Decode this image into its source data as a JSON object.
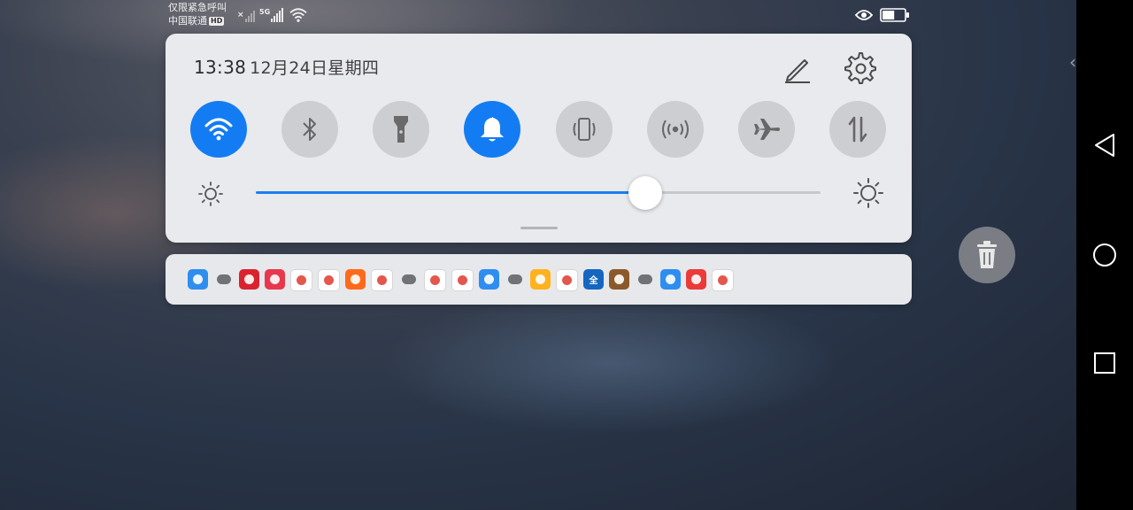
{
  "status_bar": {
    "emergency_text": "仅限紧急呼叫",
    "carrier": "中国联通",
    "hd_badge": "HD",
    "network_label": "5G",
    "battery_level": 0.55
  },
  "header": {
    "time": "13:38",
    "date": "12月24日星期四"
  },
  "toggles": [
    {
      "name": "wifi-toggle",
      "icon": "wifi-icon",
      "active": true
    },
    {
      "name": "bluetooth-toggle",
      "icon": "bluetooth-icon",
      "active": false
    },
    {
      "name": "flashlight-toggle",
      "icon": "flashlight-icon",
      "active": false
    },
    {
      "name": "sound-toggle",
      "icon": "bell-icon",
      "active": true
    },
    {
      "name": "auto-rotate-toggle",
      "icon": "rotate-phone-icon",
      "active": false
    },
    {
      "name": "hotspot-toggle",
      "icon": "hotspot-icon",
      "active": false
    },
    {
      "name": "airplane-mode-toggle",
      "icon": "airplane-icon",
      "active": false
    },
    {
      "name": "mobile-data-toggle",
      "icon": "mobile-data-icon",
      "active": false
    }
  ],
  "brightness": {
    "level": 0.69
  },
  "notification_apps": [
    {
      "icon": "wifi-app-icon",
      "color": "#2f8df0"
    },
    {
      "icon": "layers-icon",
      "color": "#e7e8eb"
    },
    {
      "icon": "checker-app-icon",
      "color": "#d9232f"
    },
    {
      "icon": "heart-app-icon",
      "color": "#e8384d"
    },
    {
      "icon": "map-pin-app-icon",
      "color": "#ffffff"
    },
    {
      "icon": "circle-app-icon",
      "color": "#ffffff"
    },
    {
      "icon": "play-orange-app-icon",
      "color": "#ff6a1a"
    },
    {
      "icon": "music-red-app-icon",
      "color": "#ffffff"
    },
    {
      "icon": "wechat-icon",
      "color": "#e7e8eb"
    },
    {
      "icon": "video-play-app-icon",
      "color": "#ffffff"
    },
    {
      "icon": "browser-app-icon",
      "color": "#ffffff"
    },
    {
      "icon": "wifi-app-icon-2",
      "color": "#2f8df0"
    },
    {
      "icon": "cloud-icon",
      "color": "#e7e8eb"
    },
    {
      "icon": "orange-app-icon",
      "color": "#ffb21f"
    },
    {
      "icon": "connect-app-icon",
      "color": "#ffffff"
    },
    {
      "icon": "quan-app-icon",
      "color": "#1566c0",
      "label": "全"
    },
    {
      "icon": "game-app-icon",
      "color": "#8a5a2a"
    },
    {
      "icon": "cloud-icon-2",
      "color": "#e7e8eb"
    },
    {
      "icon": "h-app-icon",
      "color": "#2f8df0"
    },
    {
      "icon": "red-square-app-icon",
      "color": "#ea3a3a"
    },
    {
      "icon": "music-app-icon",
      "color": "#ffffff"
    }
  ],
  "colors": {
    "accent": "#147cf3",
    "toggle_off": "#cdced2"
  }
}
